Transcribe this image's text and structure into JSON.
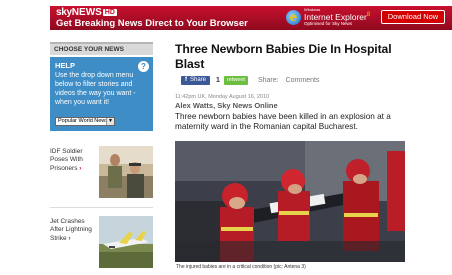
{
  "banner": {
    "brand": "sky",
    "brand_news": "NEWS",
    "brand_hd": "HD",
    "tagline": "Get Breaking News Direct to Your Browser",
    "ie_windows": "Windows",
    "ie_name": "Internet Explorer",
    "ie_version": "8",
    "ie_optimised": "Optimised for Sky News",
    "download_label": "Download Now",
    "colors": {
      "banner_red": "#c8102e",
      "button_red": "#d40000"
    }
  },
  "sidebar": {
    "header": "CHOOSE YOUR NEWS",
    "help": {
      "title": "HELP",
      "icon": "question-icon",
      "text": "Use the drop down menu below to filter stories and videos the way you want - when you want it!",
      "select_value": "Popular World News"
    },
    "stories": [
      {
        "title": "IDF Soldier Poses With Prisoners",
        "chevron": "›"
      },
      {
        "title": "Jet Crashes After Lightning Strike",
        "chevron": "›"
      }
    ]
  },
  "article": {
    "headline": "Three Newborn Babies Die In Hospital Blast",
    "share_label": "Share",
    "share_count": "1",
    "retweet_label": "retweet",
    "share_text": "Share:",
    "comments_text": "Comments",
    "date": "11:42pm UK, Monday August 16, 2010",
    "byline": "Alex Watts, Sky News Online",
    "summary": "Three newborn babies have been killed in an explosion at a maternity ward in the Romanian capital Bucharest.",
    "caption": "The injured babies are in a critical condition (pic: Antena 3)"
  }
}
